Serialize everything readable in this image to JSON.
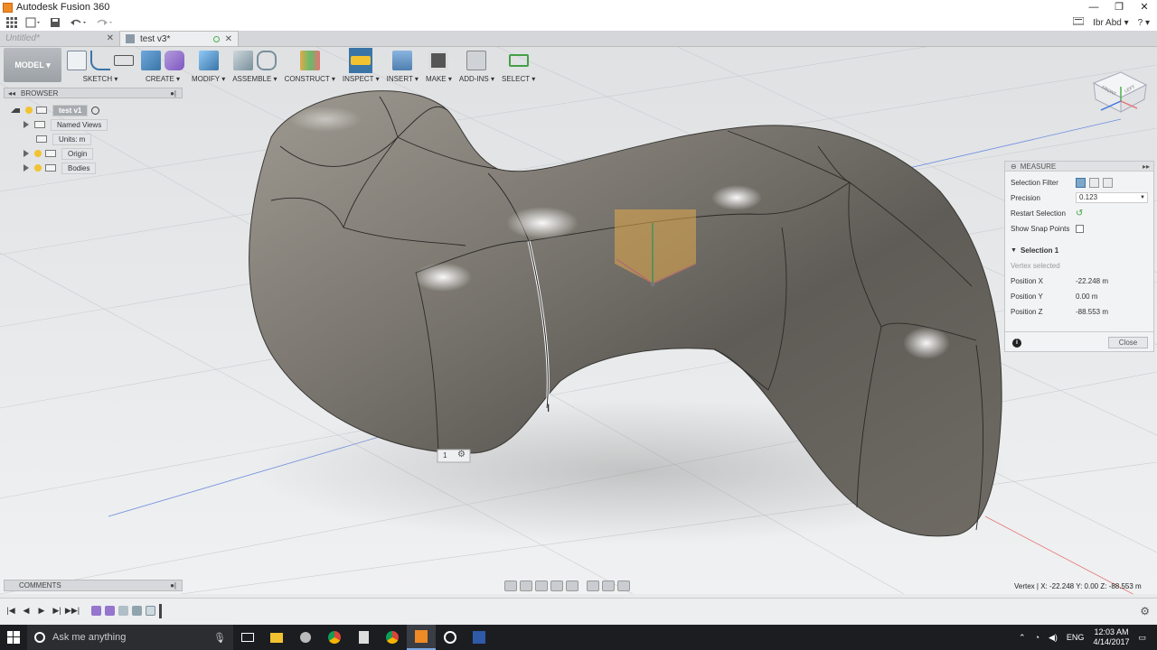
{
  "window": {
    "title": "Autodesk Fusion 360",
    "minimize": "—",
    "maximize": "❐",
    "close": "✕"
  },
  "qab": {
    "user": "Ibr Abd ▾",
    "help": "? ▾"
  },
  "tabs": [
    {
      "label": "Untitled*",
      "close": "✕"
    },
    {
      "label": "test v3*",
      "close": "✕"
    }
  ],
  "toolbar": {
    "workspace": "MODEL ▾",
    "groups": [
      {
        "label": "SKETCH ▾"
      },
      {
        "label": "CREATE ▾"
      },
      {
        "label": "MODIFY ▾"
      },
      {
        "label": "ASSEMBLE ▾"
      },
      {
        "label": "CONSTRUCT ▾"
      },
      {
        "label": "INSPECT ▾"
      },
      {
        "label": "INSERT ▾"
      },
      {
        "label": "MAKE ▾"
      },
      {
        "label": "ADD-INS ▾"
      },
      {
        "label": "SELECT ▾"
      }
    ]
  },
  "browser": {
    "title": "BROWSER",
    "root": "test v1",
    "items": [
      "Named Views",
      "Units: m",
      "Origin",
      "Bodies"
    ]
  },
  "viewcube": {
    "front": "FRONT",
    "left": "LEFT"
  },
  "measure": {
    "title": "MEASURE",
    "selection_filter": "Selection Filter",
    "precision_label": "Precision",
    "precision_value": "0.123",
    "restart_selection": "Restart Selection",
    "show_snap_points": "Show Snap Points",
    "selection_heading": "Selection 1",
    "vertex_selected": "Vertex selected",
    "pos_x_label": "Position X",
    "pos_x": "-22.248 m",
    "pos_y_label": "Position Y",
    "pos_y": "0.00 m",
    "pos_z_label": "Position Z",
    "pos_z": "-88.553 m",
    "close": "Close"
  },
  "marker": {
    "value": "1"
  },
  "comments": {
    "title": "COMMENTS"
  },
  "status": {
    "text": "Vertex | X: -22.248 Y: 0.00 Z: -88.553 m"
  },
  "timeline": {
    "controls": [
      "|◀",
      "◀",
      "▶",
      "▶|",
      "▶▶|"
    ]
  },
  "taskbar": {
    "search_placeholder": "Ask me anything",
    "lang": "ENG",
    "time": "12:03 AM",
    "date": "4/14/2017"
  },
  "colors": {
    "accent": "#3b75a7",
    "taskbar": "#1b1d21",
    "surface": "#7a7670"
  }
}
